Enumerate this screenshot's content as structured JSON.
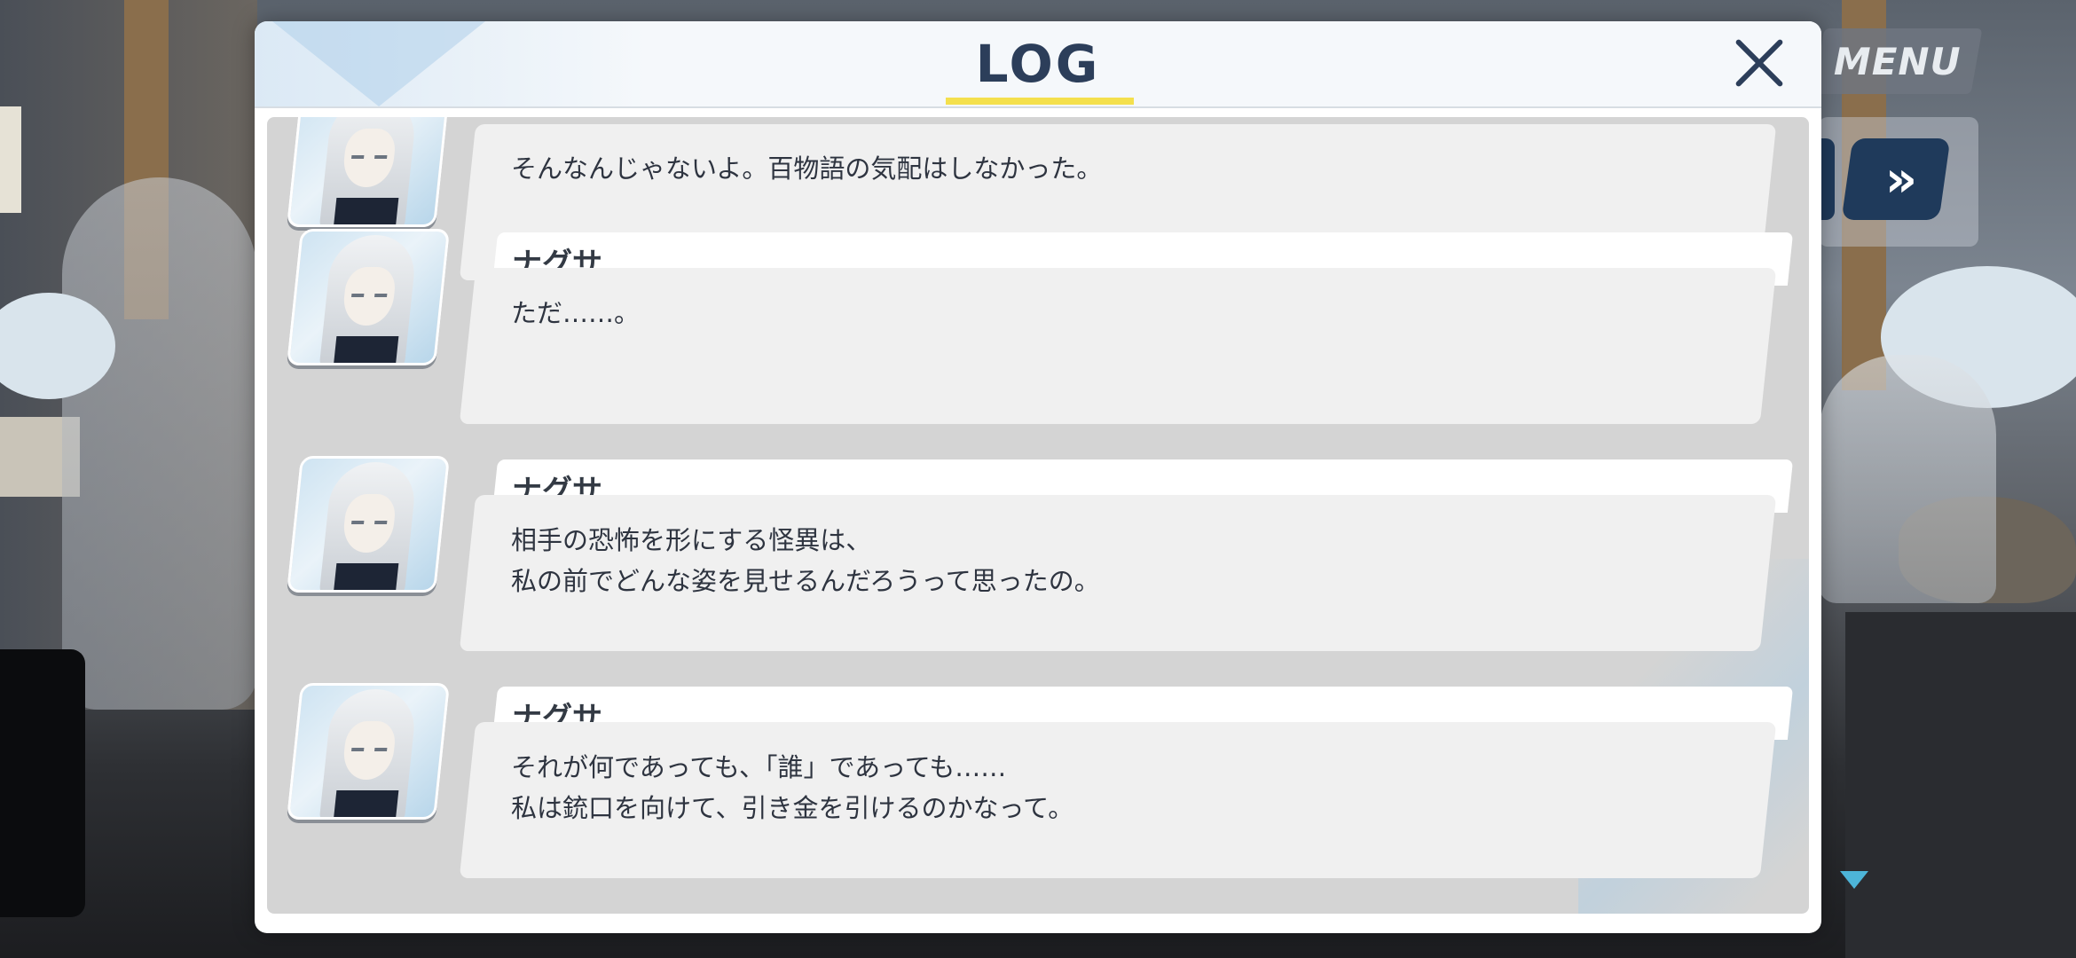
{
  "hud": {
    "menu_label": "MENU",
    "fast_forward_label": "»"
  },
  "log": {
    "title": "LOG",
    "colors": {
      "title": "#2c3e5a",
      "underline": "#f4e04d",
      "bubble": "#f0f0f0"
    },
    "entries": [
      {
        "speaker": "",
        "lines": [
          "そんなんじゃないよ。百物語の気配はしなかった。"
        ]
      },
      {
        "speaker": "ナグサ",
        "lines": [
          "ただ……。"
        ]
      },
      {
        "speaker": "ナグサ",
        "lines": [
          "相手の恐怖を形にする怪異は、",
          "私の前でどんな姿を見せるんだろうって思ったの。"
        ]
      },
      {
        "speaker": "ナグサ",
        "lines": [
          "それが何であっても、「誰」であっても……",
          "私は銃口を向けて、引き金を引けるのかなって。"
        ]
      }
    ]
  },
  "icons": {
    "close": "close-icon",
    "fast_forward": "fast-forward-icon",
    "advance": "advance-arrow-icon"
  }
}
